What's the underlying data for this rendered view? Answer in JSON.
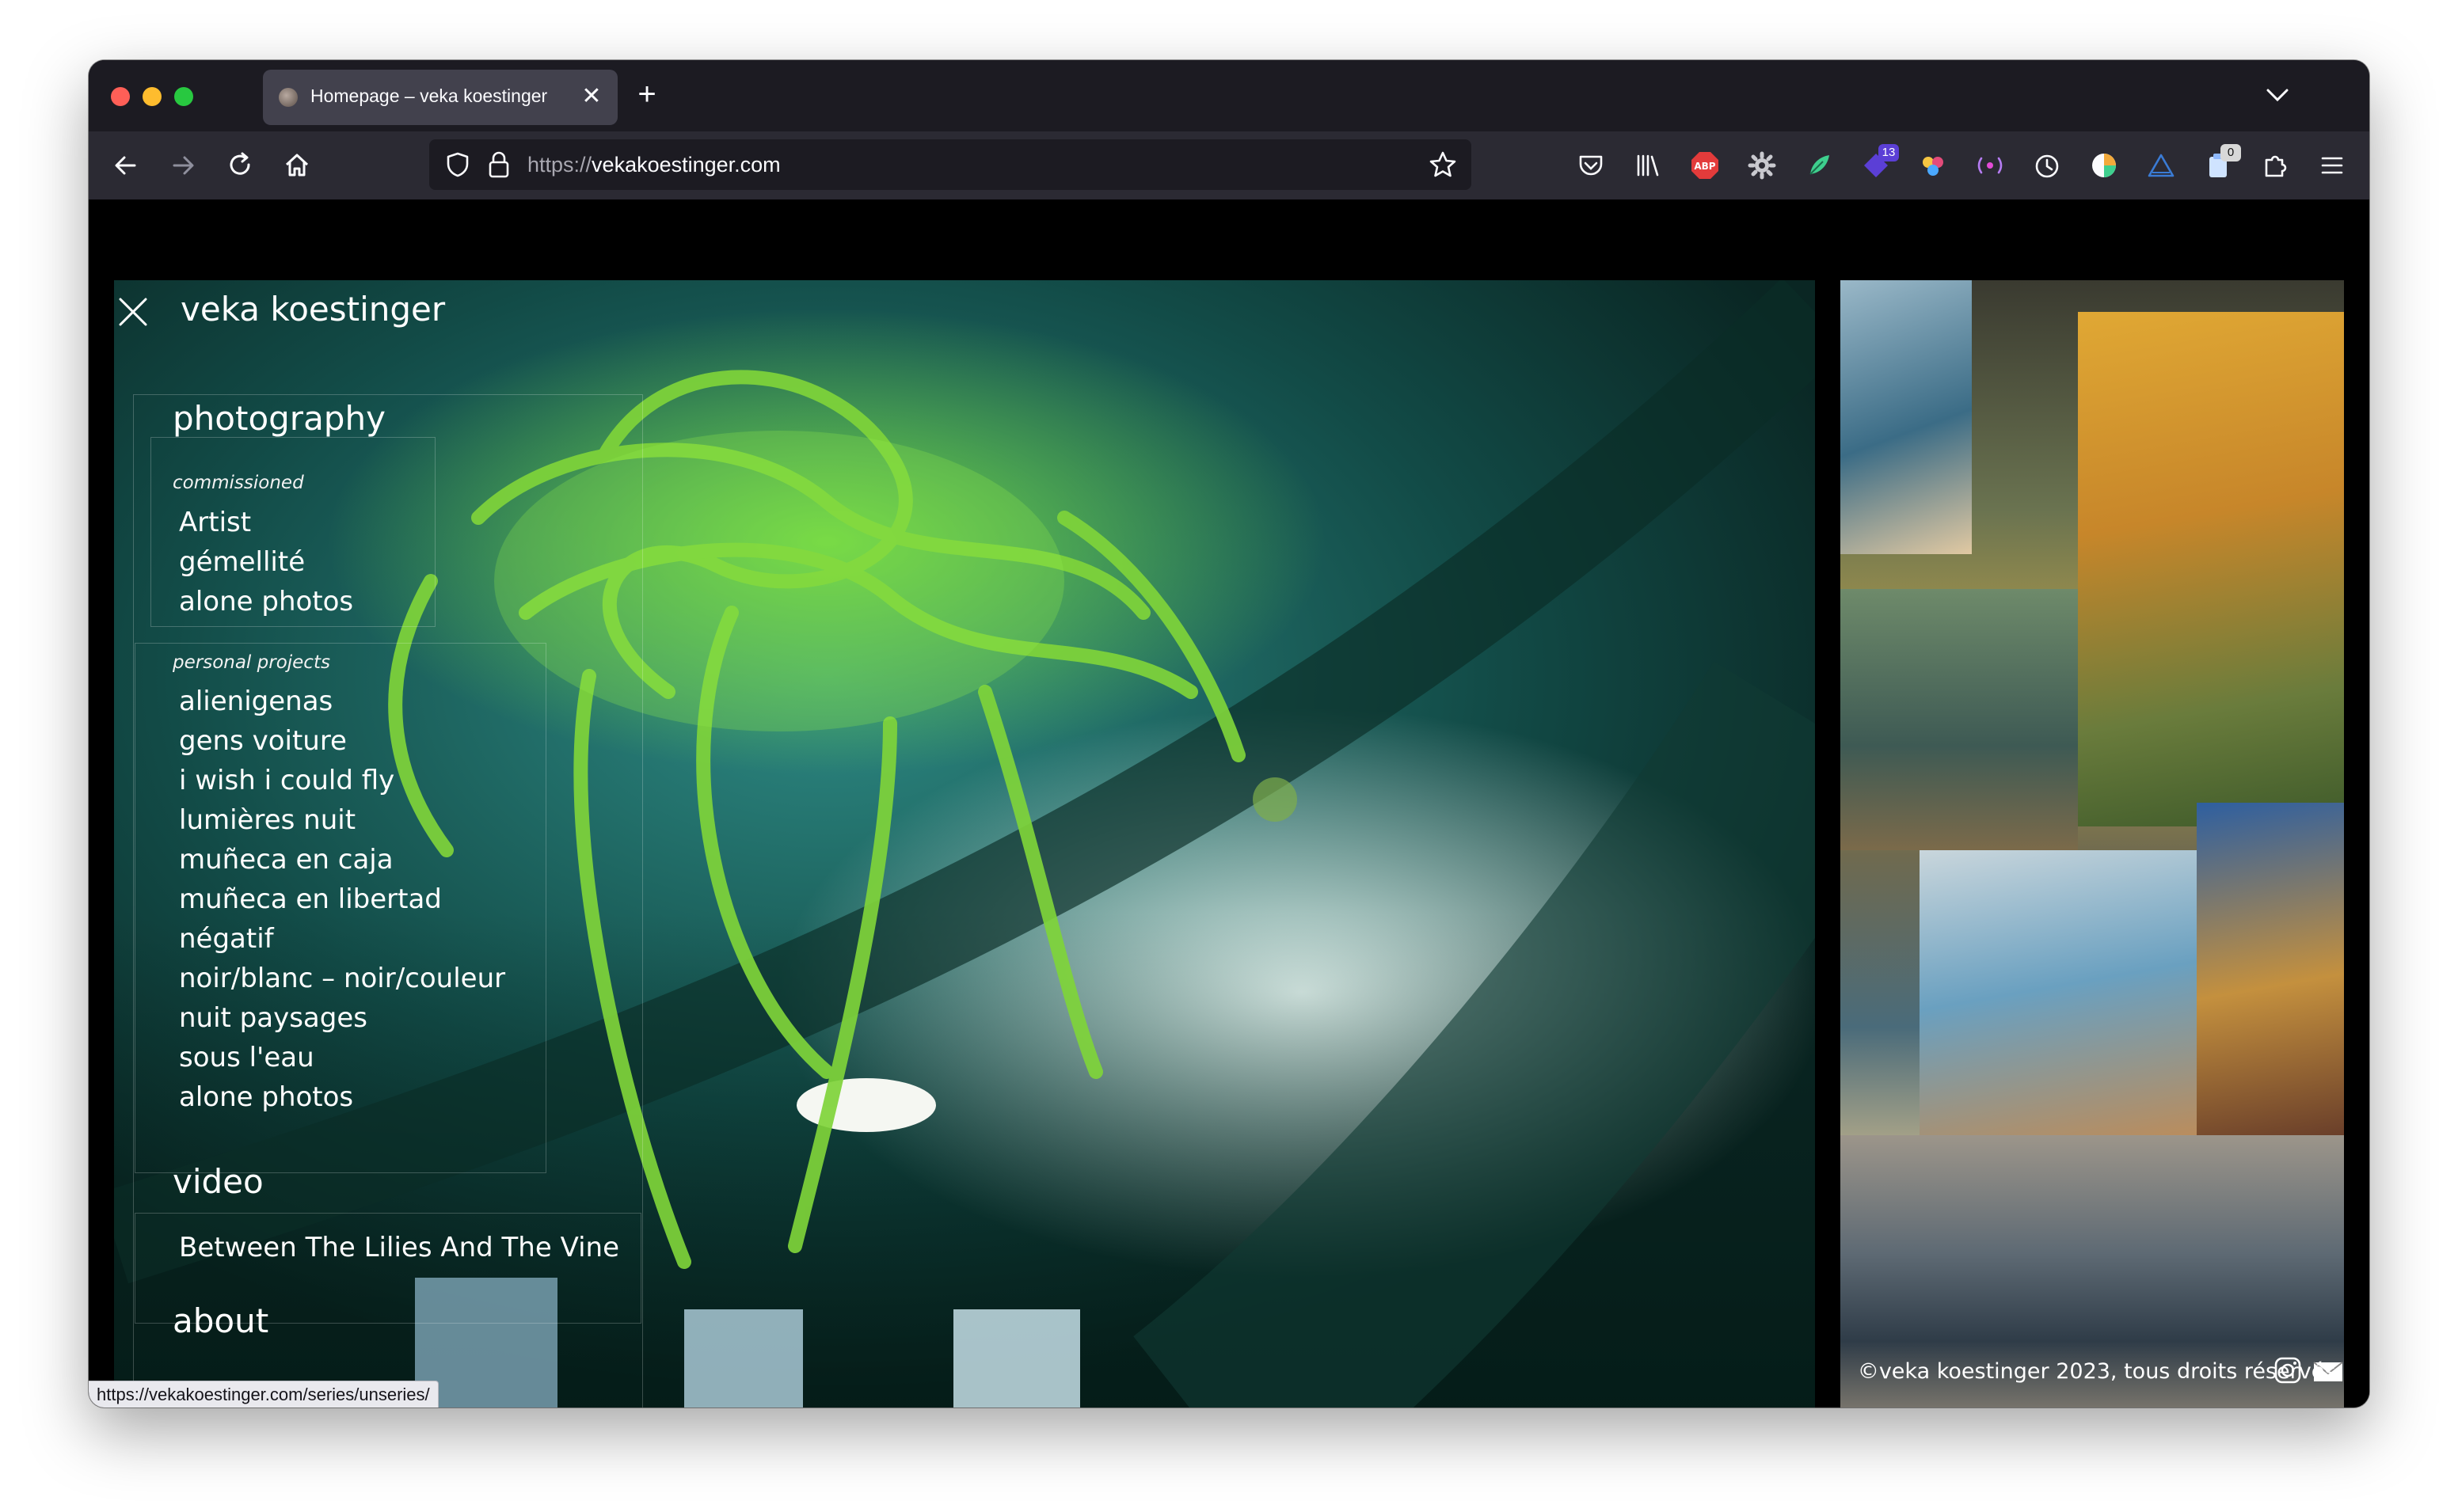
{
  "browser": {
    "tab_title": "Homepage – veka koestinger",
    "url_protocol": "https://",
    "url_host": "vekakoestinger.com",
    "status_url": "https://vekakoestinger.com/series/unseries/",
    "extension_badges": {
      "ext_5": "13",
      "ext_11": "0"
    },
    "icons": [
      "back-icon",
      "forward-icon",
      "reload-icon",
      "home-icon",
      "shield-icon",
      "lock-icon",
      "bookmark-star-icon",
      "pocket-icon",
      "library-icon",
      "adblock-icon",
      "gear-icon",
      "leaf-icon",
      "badge-icon",
      "balls-icon",
      "wave-icon",
      "timer-icon",
      "color-wheel-icon",
      "triangle-icon",
      "clipboard-icon",
      "extensions-icon",
      "menu-icon"
    ]
  },
  "site": {
    "title": "veka koestinger",
    "copyright": "©veka koestinger 2023, tous droits réservés.",
    "menu": {
      "photography": "photography",
      "commissioned_label": "commissioned",
      "commissioned": [
        "Artist",
        "gémellité",
        "alone photos"
      ],
      "personal_label": "personal projects",
      "personal": [
        "alienigenas",
        "gens voiture",
        "i wish i could fly",
        "lumières nuit",
        "muñeca en caja",
        "muñeca en libertad",
        "négatif",
        "noir/blanc – noir/couleur",
        "nuit paysages",
        "sous l'eau",
        "alone photos"
      ],
      "video": "video",
      "videos": [
        "Between The Lilies And The Vine"
      ],
      "about": "about"
    }
  },
  "colors": {
    "tabbar": "#1c1b22",
    "navbar": "#2b2a33",
    "accent_green": "#7de63c"
  }
}
